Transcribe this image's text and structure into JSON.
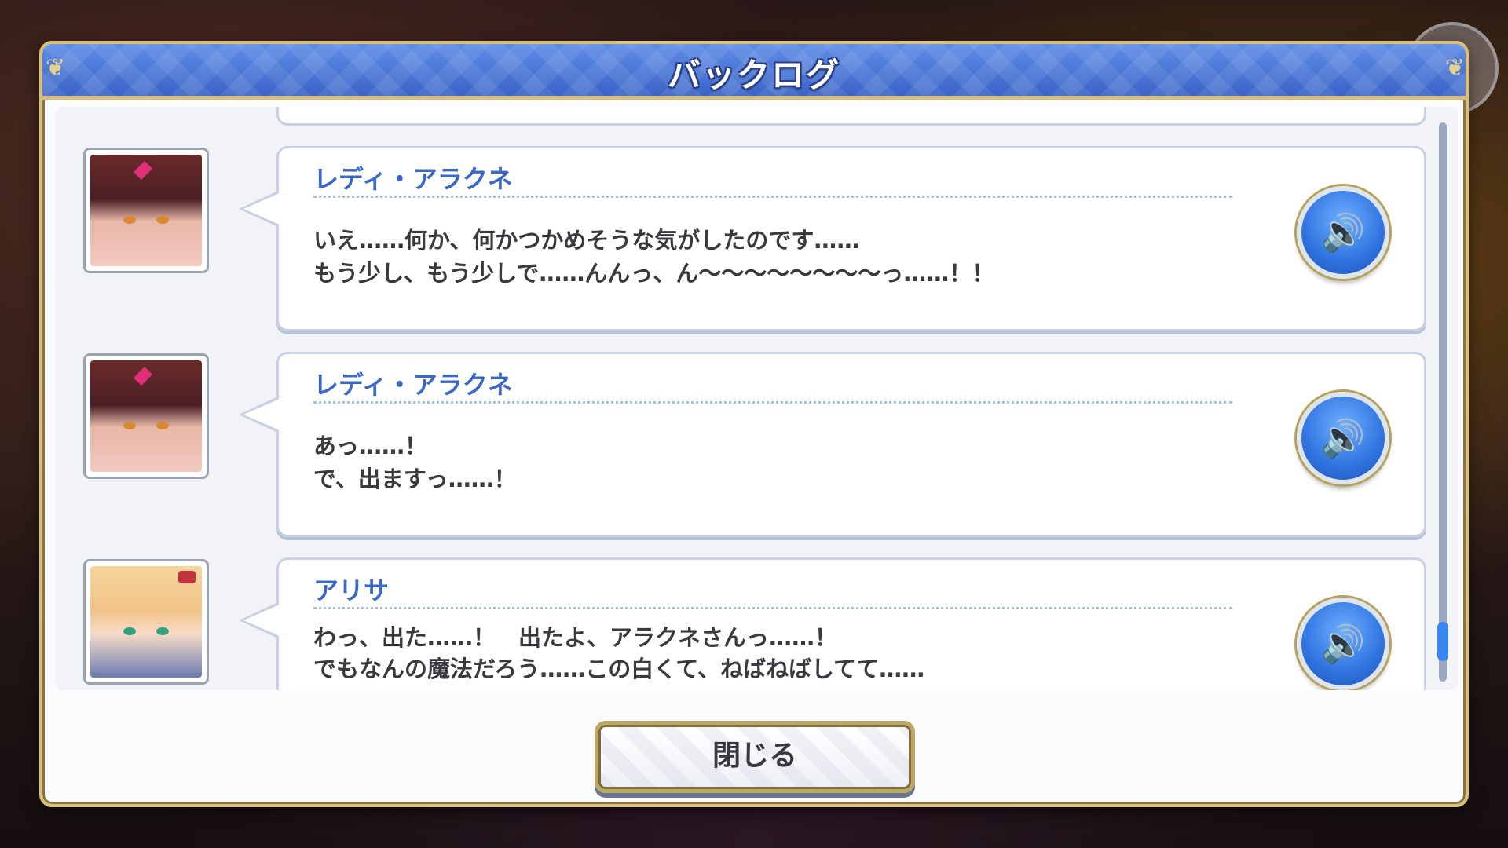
{
  "dialog": {
    "title": "バックログ",
    "close_label": "閉じる"
  },
  "entries": [
    {
      "speaker": "レディ・アラクネ",
      "lines": [
        "いえ……何か、何かつかめそうな気がしたのです……",
        "もう少し、もう少しで……んんっ、ん〜〜〜〜〜〜〜〜っ……！！"
      ],
      "avatar": "lady-arachne-portrait",
      "voice_icon": "speaker-icon"
    },
    {
      "speaker": "レディ・アラクネ",
      "lines": [
        "あっ……！",
        "で、出ますっ……！"
      ],
      "avatar": "lady-arachne-portrait",
      "voice_icon": "speaker-icon"
    },
    {
      "speaker": "アリサ",
      "lines": [
        "わっ、出た……！　出たよ、アラクネさんっ……！",
        "でもなんの魔法だろう……この白くて、ねばねばしてて……"
      ],
      "avatar": "alisa-portrait",
      "voice_icon": "speaker-icon"
    }
  ],
  "colors": {
    "title_bar": "#3a64c8",
    "frame_gold": "#d8c07a",
    "speaker_name": "#3a68c8",
    "voice_button": "#2f73e0",
    "scroll_thumb": "#3a86f0"
  }
}
